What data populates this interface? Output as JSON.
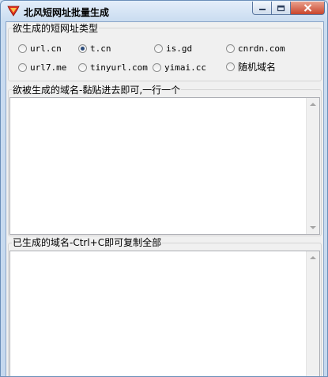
{
  "window": {
    "title": "北风短网址批量生成",
    "icon": "red-heart-shield-icon",
    "controls": [
      "minimize-icon",
      "maximize-icon",
      "close-icon"
    ],
    "close_color": "#c9452c"
  },
  "url_type_group": {
    "label": "欲生成的短网址类型",
    "options": [
      {
        "label": "url.cn",
        "checked": false
      },
      {
        "label": "t.cn",
        "checked": true
      },
      {
        "label": "is.gd",
        "checked": false
      },
      {
        "label": "cnrdn.com",
        "checked": false
      },
      {
        "label": "url7.me",
        "checked": false
      },
      {
        "label": "tinyurl.com",
        "checked": false
      },
      {
        "label": "yimai.cc",
        "checked": false
      },
      {
        "label": "随机域名",
        "checked": false
      }
    ]
  },
  "input_section": {
    "label": "欲被生成的域名-黏贴进去即可,一行一个",
    "value": ""
  },
  "output_section": {
    "label": "已生成的域名-Ctrl+C即可复制全部",
    "value": ""
  }
}
